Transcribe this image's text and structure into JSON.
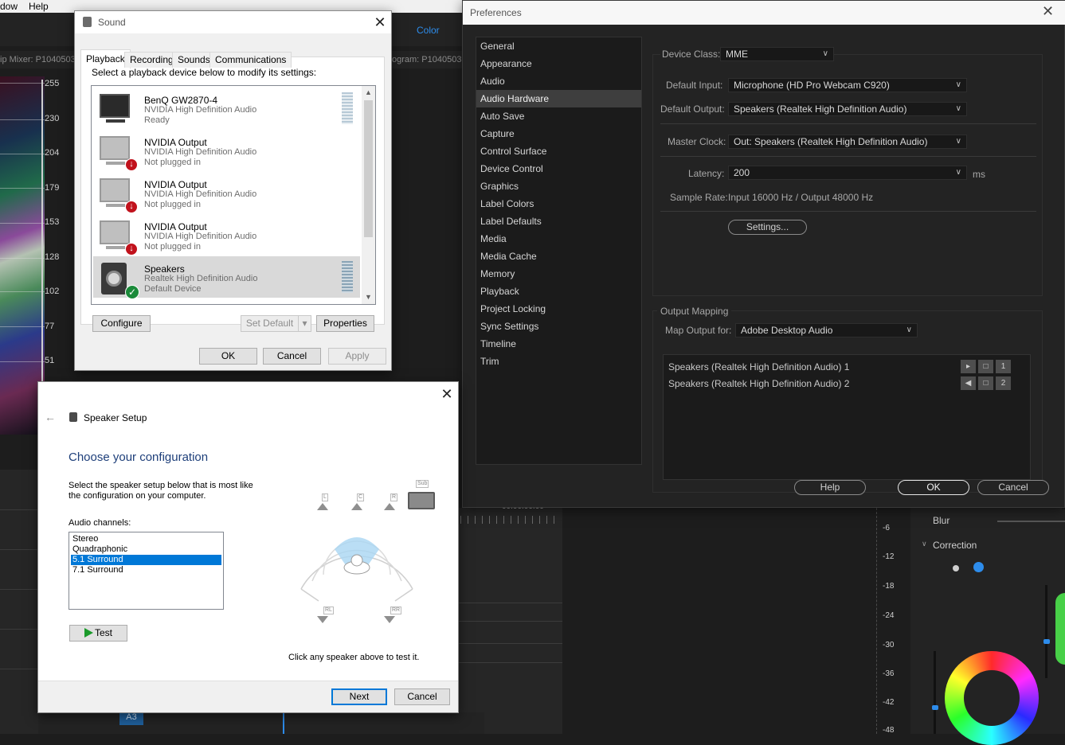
{
  "background": {
    "menu_items": [
      "dow",
      "Help"
    ],
    "color_tab": "Color",
    "clip_mixer_label": "ip Mixer: P1040503",
    "program_label": "ogram: P1040503",
    "scope_ticks": [
      "255",
      "230",
      "204",
      "179",
      "153",
      "128",
      "102",
      "77",
      "51"
    ],
    "timecode": "00:00:00:00",
    "track_label": "A3",
    "db_ticks": [
      "-6",
      "-12",
      "-18",
      "-24",
      "-30",
      "-36",
      "-42",
      "-48"
    ],
    "lumetri": {
      "blur": "Blur",
      "correction": "Correction"
    }
  },
  "sound": {
    "title": "Sound",
    "tabs": [
      "Playback",
      "Recording",
      "Sounds",
      "Communications"
    ],
    "instruction": "Select a playback device below to modify its settings:",
    "devices": [
      {
        "name": "BenQ GW2870-4",
        "driver": "NVIDIA High Definition Audio",
        "status": "Ready",
        "icon": "monitor-icon"
      },
      {
        "name": "NVIDIA Output",
        "driver": "NVIDIA High Definition Audio",
        "status": "Not plugged in",
        "icon": "unplugged-monitor-icon"
      },
      {
        "name": "NVIDIA Output",
        "driver": "NVIDIA High Definition Audio",
        "status": "Not plugged in",
        "icon": "unplugged-monitor-icon"
      },
      {
        "name": "NVIDIA Output",
        "driver": "NVIDIA High Definition Audio",
        "status": "Not plugged in",
        "icon": "unplugged-monitor-icon"
      },
      {
        "name": "Speakers",
        "driver": "Realtek High Definition Audio",
        "status": "Default Device",
        "icon": "speaker-default-icon"
      }
    ],
    "configure": "Configure",
    "set_default": "Set Default",
    "properties": "Properties",
    "ok": "OK",
    "cancel": "Cancel",
    "apply": "Apply"
  },
  "speaker_setup": {
    "title": "Speaker Setup",
    "heading": "Choose your configuration",
    "description_line1": "Select the speaker setup below that is most like",
    "description_line2": "the configuration on your computer.",
    "channels_label": "Audio channels:",
    "channels": [
      "Stereo",
      "Quadraphonic",
      "5.1 Surround",
      "7.1 Surround"
    ],
    "selected_channel": "5.1 Surround",
    "speaker_labels": {
      "sub": "Sub",
      "l": "L",
      "c": "C",
      "r": "R",
      "rl": "RL",
      "rr": "RR"
    },
    "test": "Test",
    "hint": "Click any speaker above to test it.",
    "next": "Next",
    "cancel": "Cancel"
  },
  "preferences": {
    "title": "Preferences",
    "sidebar": [
      "General",
      "Appearance",
      "Audio",
      "Audio Hardware",
      "Auto Save",
      "Capture",
      "Control Surface",
      "Device Control",
      "Graphics",
      "Label Colors",
      "Label Defaults",
      "Media",
      "Media Cache",
      "Memory",
      "Playback",
      "Project Locking",
      "Sync Settings",
      "Timeline",
      "Trim"
    ],
    "selected": "Audio Hardware",
    "device_class_label": "Device Class:",
    "device_class": "MME",
    "default_input_label": "Default Input:",
    "default_input": "Microphone (HD Pro Webcam C920)",
    "default_output_label": "Default Output:",
    "default_output": "Speakers (Realtek High Definition Audio)",
    "master_clock_label": "Master Clock:",
    "master_clock": "Out: Speakers (Realtek High Definition Audio)",
    "latency_label": "Latency:",
    "latency": "200",
    "latency_unit": "ms",
    "sample_rate_label": "Sample Rate:",
    "sample_rate": "Input 16000 Hz / Output 48000 Hz",
    "settings_button": "Settings...",
    "output_mapping_label": "Output Mapping",
    "map_output_label": "Map Output for:",
    "map_output": "Adobe Desktop Audio",
    "mappings": [
      {
        "name": "Speakers (Realtek High Definition Audio) 1",
        "channel": "1"
      },
      {
        "name": "Speakers (Realtek High Definition Audio) 2",
        "channel": "2"
      }
    ],
    "help": "Help",
    "ok": "OK",
    "cancel": "Cancel"
  }
}
